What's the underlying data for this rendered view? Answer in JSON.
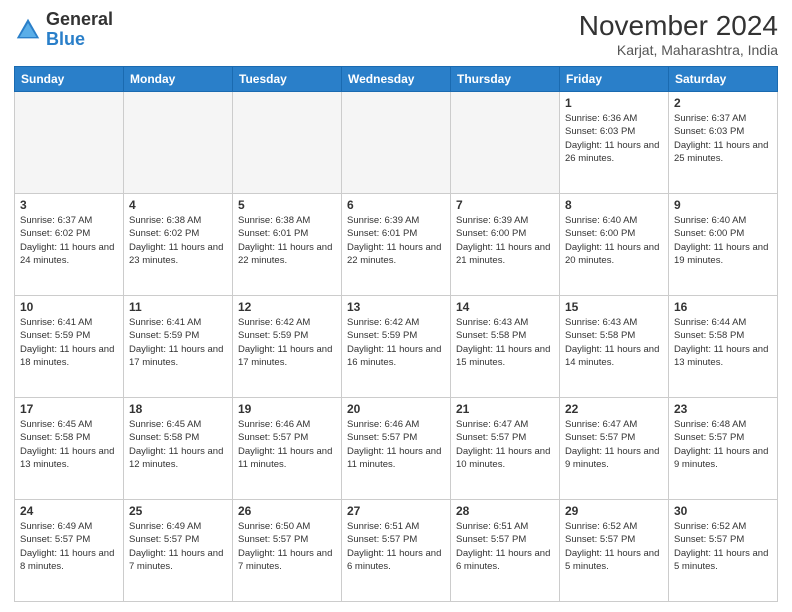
{
  "logo": {
    "general": "General",
    "blue": "Blue"
  },
  "header": {
    "month": "November 2024",
    "location": "Karjat, Maharashtra, India"
  },
  "weekdays": [
    "Sunday",
    "Monday",
    "Tuesday",
    "Wednesday",
    "Thursday",
    "Friday",
    "Saturday"
  ],
  "weeks": [
    [
      {
        "day": "",
        "empty": true
      },
      {
        "day": "",
        "empty": true
      },
      {
        "day": "",
        "empty": true
      },
      {
        "day": "",
        "empty": true
      },
      {
        "day": "",
        "empty": true
      },
      {
        "day": "1",
        "sunrise": "6:36 AM",
        "sunset": "6:03 PM",
        "daylight": "11 hours and 26 minutes."
      },
      {
        "day": "2",
        "sunrise": "6:37 AM",
        "sunset": "6:03 PM",
        "daylight": "11 hours and 25 minutes."
      }
    ],
    [
      {
        "day": "3",
        "sunrise": "6:37 AM",
        "sunset": "6:02 PM",
        "daylight": "11 hours and 24 minutes."
      },
      {
        "day": "4",
        "sunrise": "6:38 AM",
        "sunset": "6:02 PM",
        "daylight": "11 hours and 23 minutes."
      },
      {
        "day": "5",
        "sunrise": "6:38 AM",
        "sunset": "6:01 PM",
        "daylight": "11 hours and 22 minutes."
      },
      {
        "day": "6",
        "sunrise": "6:39 AM",
        "sunset": "6:01 PM",
        "daylight": "11 hours and 22 minutes."
      },
      {
        "day": "7",
        "sunrise": "6:39 AM",
        "sunset": "6:00 PM",
        "daylight": "11 hours and 21 minutes."
      },
      {
        "day": "8",
        "sunrise": "6:40 AM",
        "sunset": "6:00 PM",
        "daylight": "11 hours and 20 minutes."
      },
      {
        "day": "9",
        "sunrise": "6:40 AM",
        "sunset": "6:00 PM",
        "daylight": "11 hours and 19 minutes."
      }
    ],
    [
      {
        "day": "10",
        "sunrise": "6:41 AM",
        "sunset": "5:59 PM",
        "daylight": "11 hours and 18 minutes."
      },
      {
        "day": "11",
        "sunrise": "6:41 AM",
        "sunset": "5:59 PM",
        "daylight": "11 hours and 17 minutes."
      },
      {
        "day": "12",
        "sunrise": "6:42 AM",
        "sunset": "5:59 PM",
        "daylight": "11 hours and 17 minutes."
      },
      {
        "day": "13",
        "sunrise": "6:42 AM",
        "sunset": "5:59 PM",
        "daylight": "11 hours and 16 minutes."
      },
      {
        "day": "14",
        "sunrise": "6:43 AM",
        "sunset": "5:58 PM",
        "daylight": "11 hours and 15 minutes."
      },
      {
        "day": "15",
        "sunrise": "6:43 AM",
        "sunset": "5:58 PM",
        "daylight": "11 hours and 14 minutes."
      },
      {
        "day": "16",
        "sunrise": "6:44 AM",
        "sunset": "5:58 PM",
        "daylight": "11 hours and 13 minutes."
      }
    ],
    [
      {
        "day": "17",
        "sunrise": "6:45 AM",
        "sunset": "5:58 PM",
        "daylight": "11 hours and 13 minutes."
      },
      {
        "day": "18",
        "sunrise": "6:45 AM",
        "sunset": "5:58 PM",
        "daylight": "11 hours and 12 minutes."
      },
      {
        "day": "19",
        "sunrise": "6:46 AM",
        "sunset": "5:57 PM",
        "daylight": "11 hours and 11 minutes."
      },
      {
        "day": "20",
        "sunrise": "6:46 AM",
        "sunset": "5:57 PM",
        "daylight": "11 hours and 11 minutes."
      },
      {
        "day": "21",
        "sunrise": "6:47 AM",
        "sunset": "5:57 PM",
        "daylight": "11 hours and 10 minutes."
      },
      {
        "day": "22",
        "sunrise": "6:47 AM",
        "sunset": "5:57 PM",
        "daylight": "11 hours and 9 minutes."
      },
      {
        "day": "23",
        "sunrise": "6:48 AM",
        "sunset": "5:57 PM",
        "daylight": "11 hours and 9 minutes."
      }
    ],
    [
      {
        "day": "24",
        "sunrise": "6:49 AM",
        "sunset": "5:57 PM",
        "daylight": "11 hours and 8 minutes."
      },
      {
        "day": "25",
        "sunrise": "6:49 AM",
        "sunset": "5:57 PM",
        "daylight": "11 hours and 7 minutes."
      },
      {
        "day": "26",
        "sunrise": "6:50 AM",
        "sunset": "5:57 PM",
        "daylight": "11 hours and 7 minutes."
      },
      {
        "day": "27",
        "sunrise": "6:51 AM",
        "sunset": "5:57 PM",
        "daylight": "11 hours and 6 minutes."
      },
      {
        "day": "28",
        "sunrise": "6:51 AM",
        "sunset": "5:57 PM",
        "daylight": "11 hours and 6 minutes."
      },
      {
        "day": "29",
        "sunrise": "6:52 AM",
        "sunset": "5:57 PM",
        "daylight": "11 hours and 5 minutes."
      },
      {
        "day": "30",
        "sunrise": "6:52 AM",
        "sunset": "5:57 PM",
        "daylight": "11 hours and 5 minutes."
      }
    ]
  ]
}
